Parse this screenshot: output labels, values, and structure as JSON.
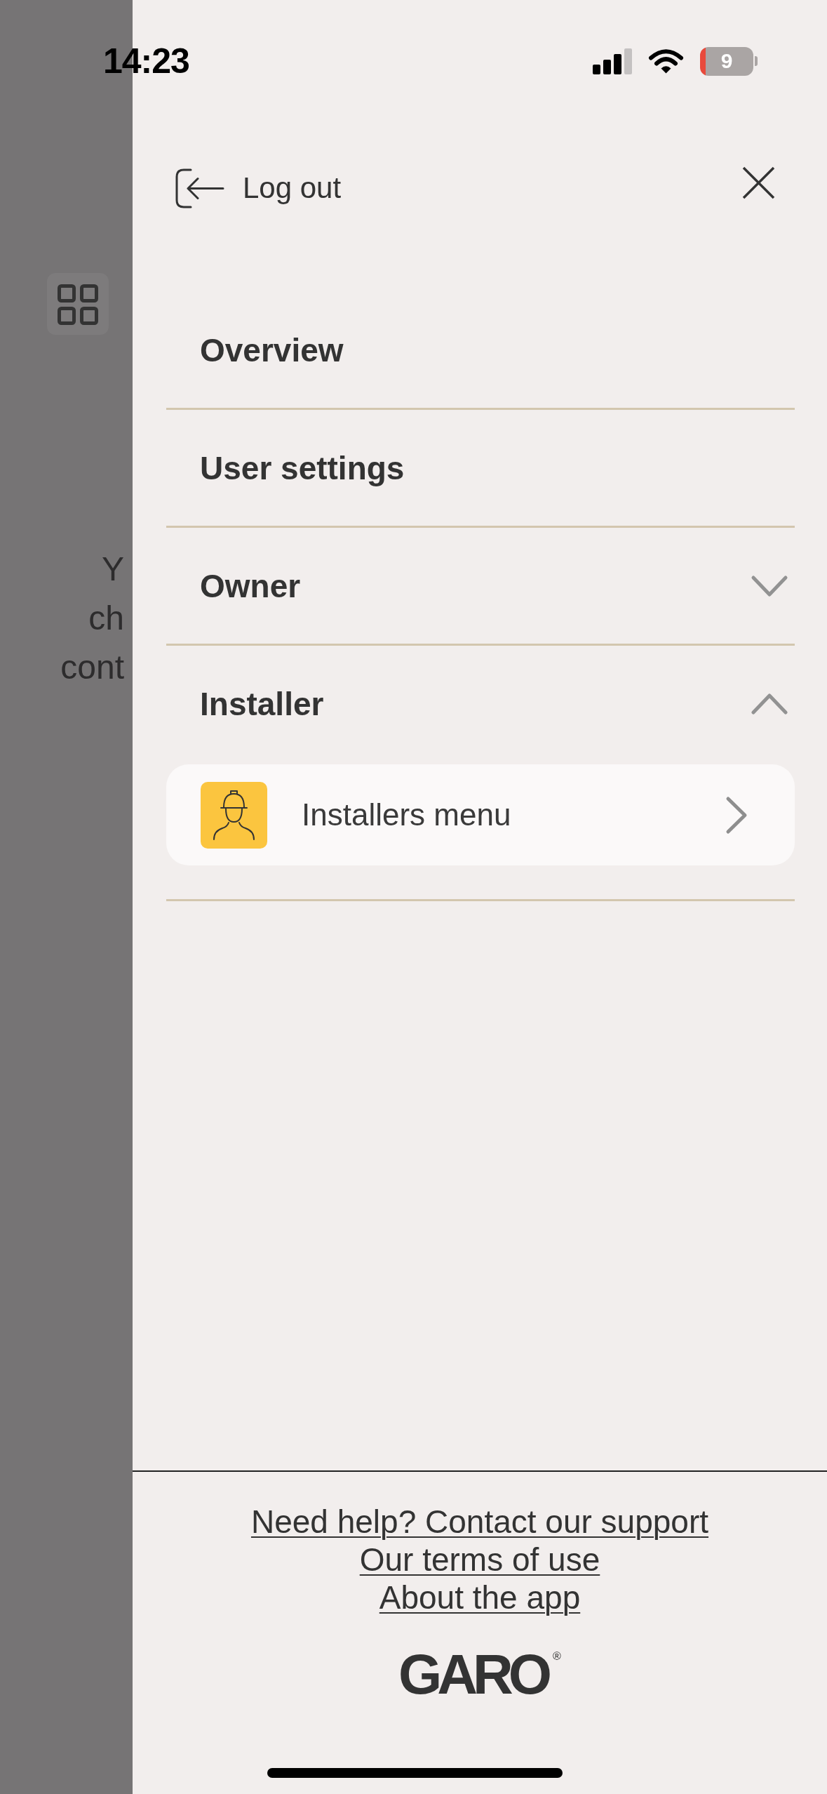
{
  "status_bar": {
    "time": "14:23",
    "battery": "9"
  },
  "background_page": {
    "text_lines": [
      "Y",
      "ch",
      "cont"
    ]
  },
  "drawer": {
    "logout": {
      "label": "Log out"
    },
    "menu": [
      {
        "kind": "link",
        "label": "Overview"
      },
      {
        "kind": "link",
        "label": "User settings"
      },
      {
        "kind": "group",
        "label": "Owner",
        "expanded": false
      },
      {
        "kind": "group",
        "label": "Installer",
        "expanded": true,
        "children": [
          {
            "label": "Installers menu"
          }
        ]
      }
    ],
    "footer_links": [
      "Need help? Contact our support",
      "Our terms of use",
      "About the app"
    ],
    "logo": {
      "text": "GARO",
      "mark": "®"
    }
  }
}
